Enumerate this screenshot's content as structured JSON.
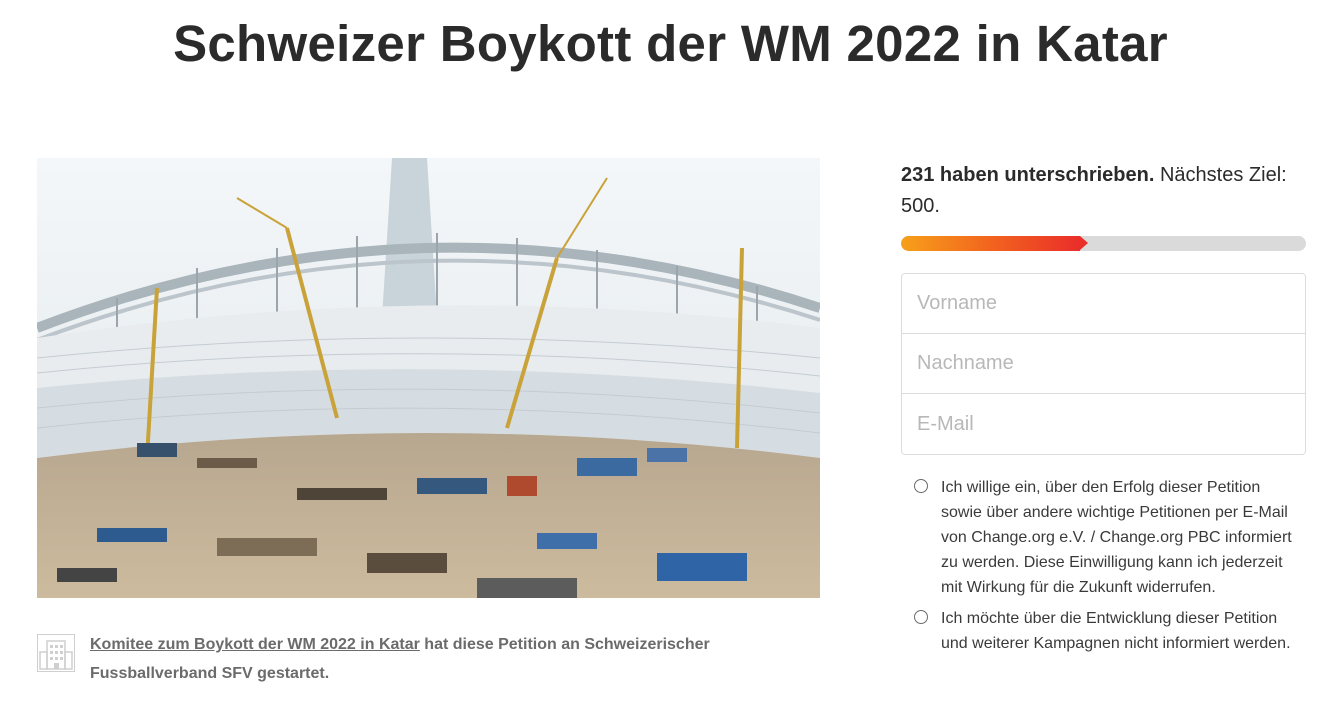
{
  "page": {
    "title": "Schweizer Boykott der WM 2022 in Katar"
  },
  "hero": {
    "description_icon": "stadium-construction-photo"
  },
  "starter": {
    "icon": "building-icon",
    "author_link": "Komitee zum Boykott der WM 2022 in Katar",
    "text": " hat diese Petition an Schweizerischer Fussballverband SFV gestartet."
  },
  "signatures": {
    "count_text": "231 haben unterschrieben.",
    "goal_text": " Nächstes Ziel: 500.",
    "signed": 231,
    "goal": 500,
    "colors": {
      "start": "#f7a01a",
      "end": "#ea2e2a",
      "track": "#dadada"
    }
  },
  "form": {
    "first_name_placeholder": "Vorname",
    "last_name_placeholder": "Nachname",
    "email_placeholder": "E-Mail"
  },
  "consent": {
    "opt_in": "Ich willige ein, über den Erfolg dieser Petition sowie über andere wichtige Petitionen per E-Mail von Change.org e.V. / Change.org PBC informiert zu werden. Diese Einwilligung kann ich jederzeit mit Wirkung für die Zukunft widerrufen.",
    "opt_out": "Ich möchte über die Entwicklung dieser Petition und weiterer Kampagnen nicht informiert werden."
  }
}
